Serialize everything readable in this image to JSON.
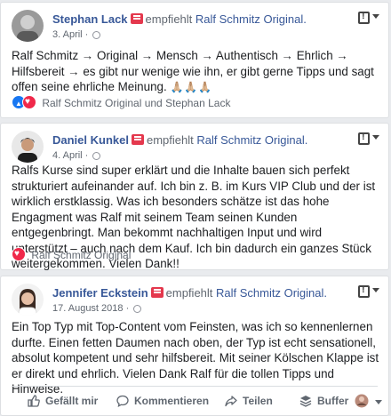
{
  "recommends_text": "empfiehlt",
  "page_name": "Ralf Schmitz Original.",
  "posts": [
    {
      "author": "Stephan Lack",
      "date": "3. April ·",
      "text": "Ralf Schmitz → Original → Mensch → Authentisch → Ehrlich → Hilfsbereit → es gibt nur wenige wie ihn, er gibt gerne Tipps und sagt offen seine ehrliche Meinung.",
      "emojis": "🙏🏼🙏🏼🙏🏼",
      "reactions": "Ralf Schmitz Original und Stephan Lack"
    },
    {
      "author": "Daniel Kunkel",
      "date": "4. April ·",
      "text": "Ralfs Kurse sind super erklärt und die Inhalte bauen sich perfekt strukturiert aufeinander auf. Ich bin z. B. im Kurs VIP Club und der ist wirklich erstklassig. Was ich besonders schätze ist das hohe Engagment was Ralf mit seinem Team seinen Kunden entgegenbringt. Man bekommt nachhaltigen Input und wird unterstützt – auch nach dem Kauf. Ich bin dadurch ein ganzes Stück weitergekommen. Vielen Dank!!",
      "reactions": "Ralf Schmitz Original"
    },
    {
      "author": "Jennifer Eckstein",
      "date": "17. August 2018 ·",
      "text": "Ein Top Typ mit Top-Content vom Feinsten, was ich so kennenlernen durfte. Einen fetten Daumen nach oben, der Typ ist echt sensationell, absolut kompetent und sehr hilfsbereit. Mit seiner Kölschen Klappe ist er direkt und ehrlich. Vielen Dank Ralf für die tollen Tipps und Hinweise."
    }
  ],
  "actions": {
    "like": "Gefällt mir",
    "comment": "Kommentieren",
    "share": "Teilen",
    "buffer": "Buffer"
  },
  "colors": {
    "link": "#385898",
    "background": "#e9ebee",
    "like_blue": "#1877f2",
    "love_red": "#f0284a"
  }
}
